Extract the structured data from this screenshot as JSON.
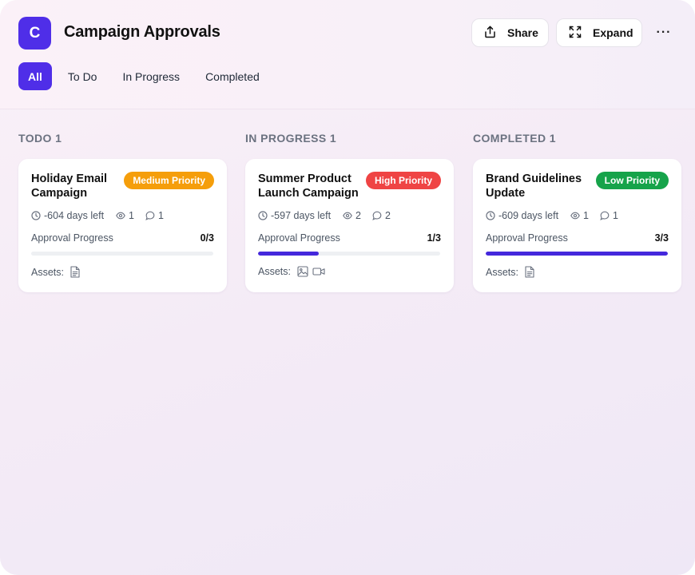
{
  "app": {
    "logo_letter": "C",
    "title": "Campaign Approvals"
  },
  "header_actions": {
    "share_label": "Share",
    "expand_label": "Expand",
    "more_label": "···"
  },
  "tabs": [
    {
      "label": "All",
      "active": true
    },
    {
      "label": "To Do",
      "active": false
    },
    {
      "label": "In Progress",
      "active": false
    },
    {
      "label": "Completed",
      "active": false
    }
  ],
  "columns": [
    {
      "title": "TODO 1",
      "card": {
        "title": "Holiday Email Campaign",
        "priority": "Medium Priority",
        "priority_color": "#f59e0b",
        "days_left": "-604 days left",
        "views": "1",
        "comments": "1",
        "progress_label": "Approval Progress",
        "progress_count": "0/3",
        "progress_fraction": 0,
        "assets_label": "Assets:",
        "assets": [
          "document-icon"
        ]
      }
    },
    {
      "title": "IN PROGRESS 1",
      "card": {
        "title": "Summer Product Launch Campaign",
        "priority": "High Priority",
        "priority_color": "#ef4444",
        "days_left": "-597 days left",
        "views": "2",
        "comments": "2",
        "progress_label": "Approval Progress",
        "progress_count": "1/3",
        "progress_fraction": 0.333,
        "assets_label": "Assets:",
        "assets": [
          "image-icon",
          "video-icon"
        ]
      }
    },
    {
      "title": "COMPLETED 1",
      "card": {
        "title": "Brand Guidelines Update",
        "priority": "Low Priority",
        "priority_color": "#16a34a",
        "days_left": "-609 days left",
        "views": "1",
        "comments": "1",
        "progress_label": "Approval Progress",
        "progress_count": "3/3",
        "progress_fraction": 1,
        "assets_label": "Assets:",
        "assets": [
          "document-icon"
        ]
      }
    }
  ]
}
